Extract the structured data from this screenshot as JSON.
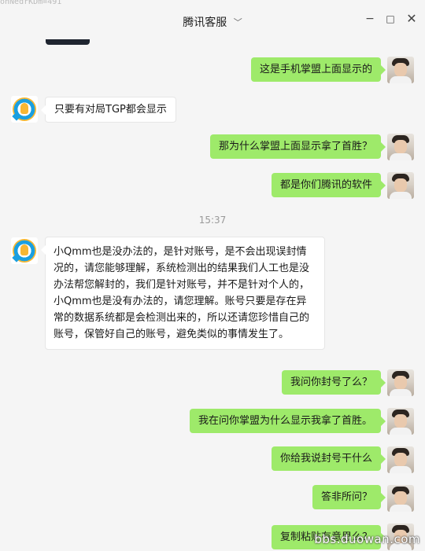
{
  "window": {
    "title": "腾讯客服",
    "title_chevron_icon": "chevron-down-icon",
    "min_icon": "minimize-icon",
    "max_icon": "maximize-icon",
    "close_icon": "close-icon",
    "min_glyph": "−",
    "max_glyph": "□",
    "close_glyph": "✕",
    "chevron_glyph": "﹀",
    "top_cut_text": "onNedrKDm=491"
  },
  "colors": {
    "my_bubble": "#9eea6a",
    "their_bubble": "#ffffff",
    "background": "#f5f5f5"
  },
  "messages": [
    {
      "from": "me",
      "text": "这是手机掌盟上面显示的"
    },
    {
      "from": "them",
      "text": "只要有对局TGP都会显示"
    },
    {
      "from": "me",
      "text": "那为什么掌盟上面显示拿了首胜？"
    },
    {
      "from": "me",
      "text": "都是你们腾讯的软件"
    },
    {
      "type": "time",
      "text": "15:37"
    },
    {
      "from": "them",
      "text": "小Qmm也是没办法的，是针对账号，是不会出现误封情况的，请您能够理解，系统检测出的结果我们人工也是没办法帮您解封的，我们是针对账号，并不是针对个人的，小Qmm也是没有办法的，请您理解。账号只要是存在异常的数据系统都是会检测出来的，所以还请您珍惜自己的账号，保管好自己的账号，避免类似的事情发生了。"
    },
    {
      "from": "me",
      "text": "我问你封号了么？"
    },
    {
      "from": "me",
      "text": "我在问你掌盟为什么显示我拿了首胜。"
    },
    {
      "from": "me",
      "text": "你给我说封号干什么"
    },
    {
      "from": "me",
      "text": "答非所问？"
    },
    {
      "from": "me",
      "text": "复制粘贴有意思么？"
    }
  ],
  "watermark": "bbs.duowan.com"
}
